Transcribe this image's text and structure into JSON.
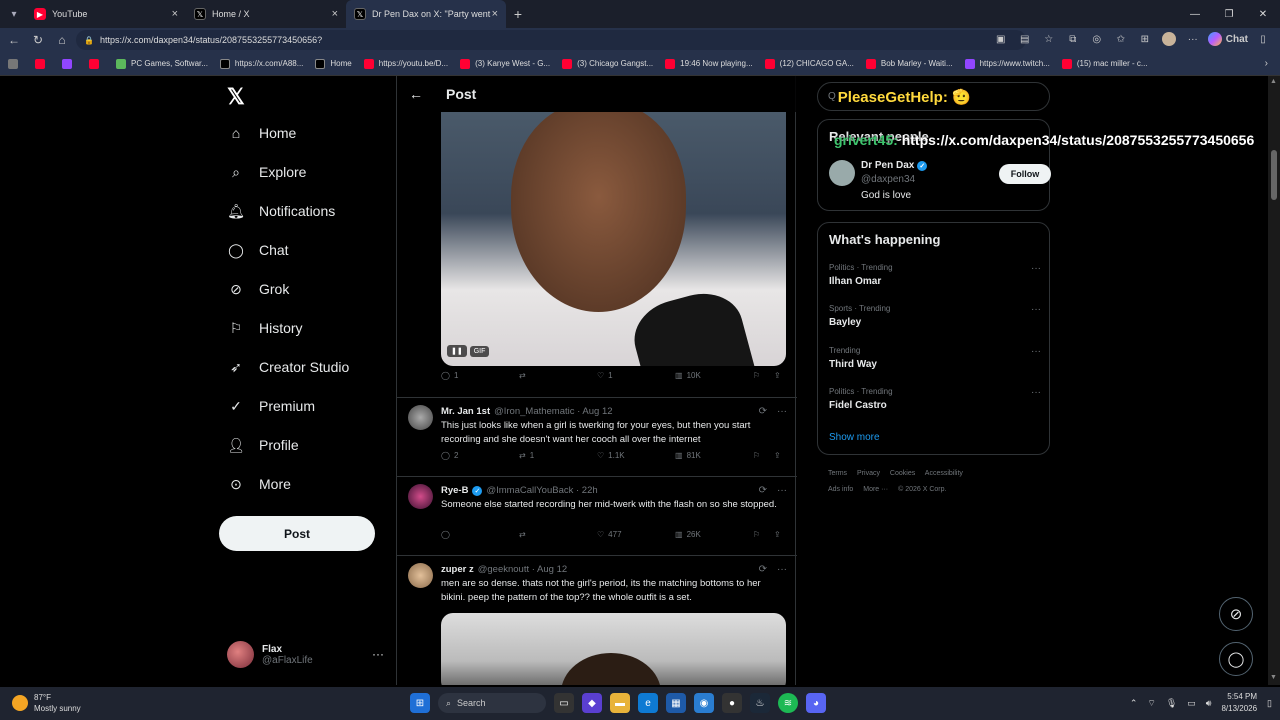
{
  "browser": {
    "tabs": [
      {
        "title": "YouTube",
        "icon": "youtube-icon"
      },
      {
        "title": "Home / X",
        "icon": "x-icon"
      },
      {
        "title": "Dr Pen Dax on X: \"Party went wron",
        "icon": "x-icon"
      }
    ],
    "url": "https://x.com/daxpen34/status/2087553255773450656?",
    "copilot_label": "Chat",
    "bookmarks": [
      {
        "label": "",
        "icon": "youtube-icon"
      },
      {
        "label": "",
        "icon": "twitch-icon"
      },
      {
        "label": "",
        "icon": "youtube-icon"
      },
      {
        "label": "PC Games, Softwar...",
        "icon": "games-icon"
      },
      {
        "label": "https://x.com/A88...",
        "icon": "x-icon"
      },
      {
        "label": "Home",
        "icon": "x-icon"
      },
      {
        "label": "https://youtu.be/D...",
        "icon": "youtube-icon"
      },
      {
        "label": "(3) Kanye West - G...",
        "icon": "youtube-icon"
      },
      {
        "label": "(3) Chicago Gangst...",
        "icon": "youtube-icon"
      },
      {
        "label": "19:46 Now playing...",
        "icon": "youtube-icon"
      },
      {
        "label": "(12) CHICAGO GA...",
        "icon": "youtube-icon"
      },
      {
        "label": "Bob Marley - Waiti...",
        "icon": "youtube-icon"
      },
      {
        "label": "https://www.twitch...",
        "icon": "twitch-icon"
      },
      {
        "label": "(15) mac miller - c...",
        "icon": "youtube-icon"
      }
    ]
  },
  "nav": {
    "items": [
      "Home",
      "Explore",
      "Notifications",
      "Chat",
      "Grok",
      "History",
      "Creator Studio",
      "Premium",
      "Profile",
      "More"
    ],
    "post_label": "Post",
    "account_name": "Flax",
    "account_handle": "@aFlaxLife"
  },
  "header": {
    "title": "Post"
  },
  "main_post": {
    "gif_label": "GIF",
    "replies": "1",
    "likes": "1",
    "views": "10K"
  },
  "replies": [
    {
      "name": "Mr. Jan 1st",
      "handle": "@Iron_Mathematic · Aug 12",
      "text": "This just looks like when a girl is twerking for your eyes, but then you start recording and she doesn't want her cooch all over the internet",
      "replies": "2",
      "reposts": "1",
      "likes": "1.1K",
      "views": "81K"
    },
    {
      "name": "Rye-B",
      "handle": "@ImmaCallYouBack · 22h",
      "text": "Someone else started recording her mid-twerk with the flash on so she stopped.",
      "replies": "",
      "reposts": "",
      "likes": "477",
      "views": "26K"
    },
    {
      "name": "zuper z",
      "handle": "@geeknoutt · Aug 12",
      "text": "men are so dense. thats not the girl's period, its the matching bottoms to her bikini. peep the pattern of the top?? the whole outfit is a set."
    }
  ],
  "sidebar": {
    "search_overlay": "PleaseGetHelp: 🫡",
    "search_prefix": "Q",
    "overlay_user": "grivert45:",
    "overlay_link": "https://x.com/daxpen34/status/2087553255773450656",
    "relevant_title": "Relevant people",
    "person_name": "Dr Pen Dax",
    "person_handle": "@daxpen34",
    "person_bio": "God is love",
    "follow_label": "Follow",
    "happening_title": "What's happening",
    "trends": [
      {
        "context": "Politics · Trending",
        "name": "Ilhan Omar"
      },
      {
        "context": "Sports · Trending",
        "name": "Bayley"
      },
      {
        "context": "Trending",
        "name": "Third Way"
      },
      {
        "context": "Politics · Trending",
        "name": "Fidel Castro"
      }
    ],
    "show_more": "Show more",
    "footer_links": [
      "Terms",
      "Privacy",
      "Cookies",
      "Accessibility",
      "Ads info",
      "More ···",
      "© 2026 X Corp."
    ]
  },
  "taskbar": {
    "temp": "87°F",
    "weather": "Mostly sunny",
    "search_label": "Search",
    "time": "5:54 PM",
    "date": "8/13/2026"
  },
  "colors": {
    "accent": "#1d9bf0",
    "background": "#000000",
    "overlay_yellow": "#ffd93d",
    "overlay_green": "#3ec46d"
  }
}
